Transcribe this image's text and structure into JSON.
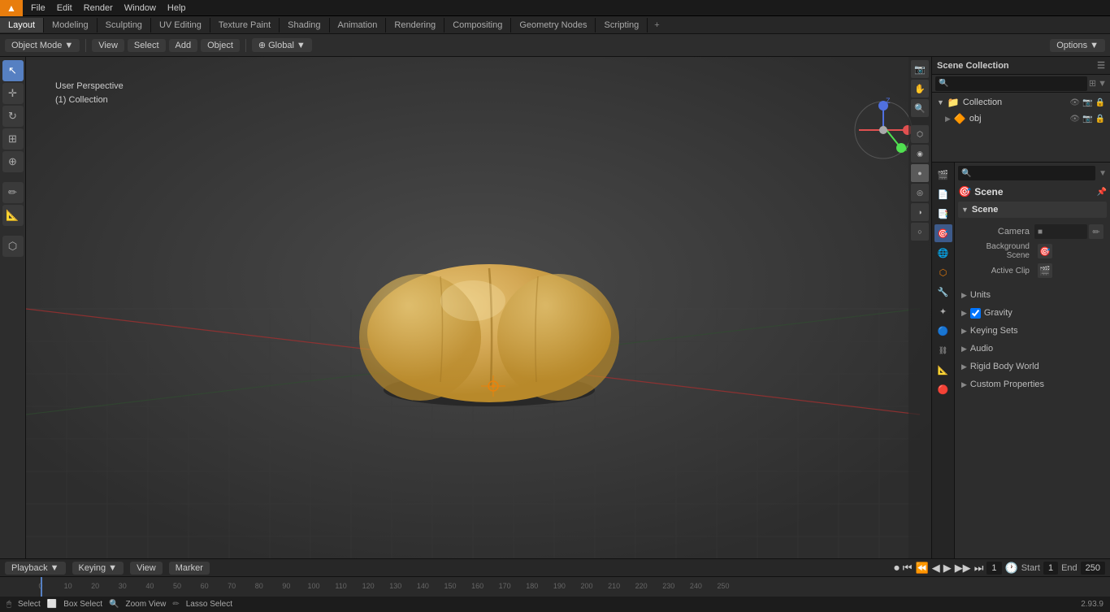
{
  "app": {
    "title": "Blender",
    "version": "2.93.9"
  },
  "top_menu": {
    "logo": "▲",
    "items": [
      "File",
      "Edit",
      "Render",
      "Window",
      "Help"
    ]
  },
  "workspace_tabs": {
    "tabs": [
      "Layout",
      "Modeling",
      "Sculpting",
      "UV Editing",
      "Texture Paint",
      "Shading",
      "Animation",
      "Rendering",
      "Compositing",
      "Geometry Nodes",
      "Scripting"
    ],
    "active": "Layout",
    "add_label": "+"
  },
  "viewport": {
    "mode_label": "Object Mode",
    "view_label": "View",
    "select_label": "Select",
    "add_label": "Add",
    "object_label": "Object",
    "perspective_label": "User Perspective",
    "collection_label": "(1) Collection",
    "global_label": "Global"
  },
  "outliner": {
    "title": "Scene Collection",
    "search_placeholder": "🔍",
    "items": [
      {
        "indent": 0,
        "icon": "📁",
        "label": "Collection",
        "icons_right": [
          "👁",
          "📷",
          "🔒"
        ]
      },
      {
        "indent": 1,
        "icon": "🔶",
        "label": "obj",
        "icons_right": [
          "👁",
          "📷",
          "🔒"
        ]
      }
    ]
  },
  "properties": {
    "title": "Scene",
    "sections": {
      "scene": {
        "title": "Scene",
        "camera_label": "Camera",
        "background_scene_label": "Background Scene",
        "active_clip_label": "Active Clip"
      },
      "units": {
        "label": "Units"
      },
      "gravity": {
        "label": "Gravity",
        "checked": true
      },
      "keying_sets": {
        "label": "Keying Sets"
      },
      "audio": {
        "label": "Audio"
      },
      "rigid_body_world": {
        "label": "Rigid Body World"
      },
      "custom_properties": {
        "label": "Custom Properties"
      }
    },
    "sidebar_icons": [
      "🎬",
      "🔧",
      "📐",
      "🎯",
      "⚙",
      "🌐",
      "🔴",
      "🔲"
    ]
  },
  "timeline": {
    "playback_label": "Playback",
    "keying_label": "Keying",
    "view_label": "View",
    "marker_label": "Marker",
    "frame_current": "1",
    "start_label": "Start",
    "start_value": "1",
    "end_label": "End",
    "end_value": "250",
    "numbers": [
      "0",
      "10",
      "20",
      "30",
      "40",
      "50",
      "60",
      "70",
      "80",
      "90",
      "100",
      "110",
      "120",
      "130",
      "140",
      "150",
      "160",
      "170",
      "180",
      "190",
      "200",
      "210",
      "220",
      "230",
      "240",
      "250"
    ]
  },
  "status_bar": {
    "select_label": "Select",
    "box_select_label": "Box Select",
    "zoom_view_label": "Zoom View",
    "lasso_select_label": "Lasso Select",
    "version": "2.93.9"
  }
}
